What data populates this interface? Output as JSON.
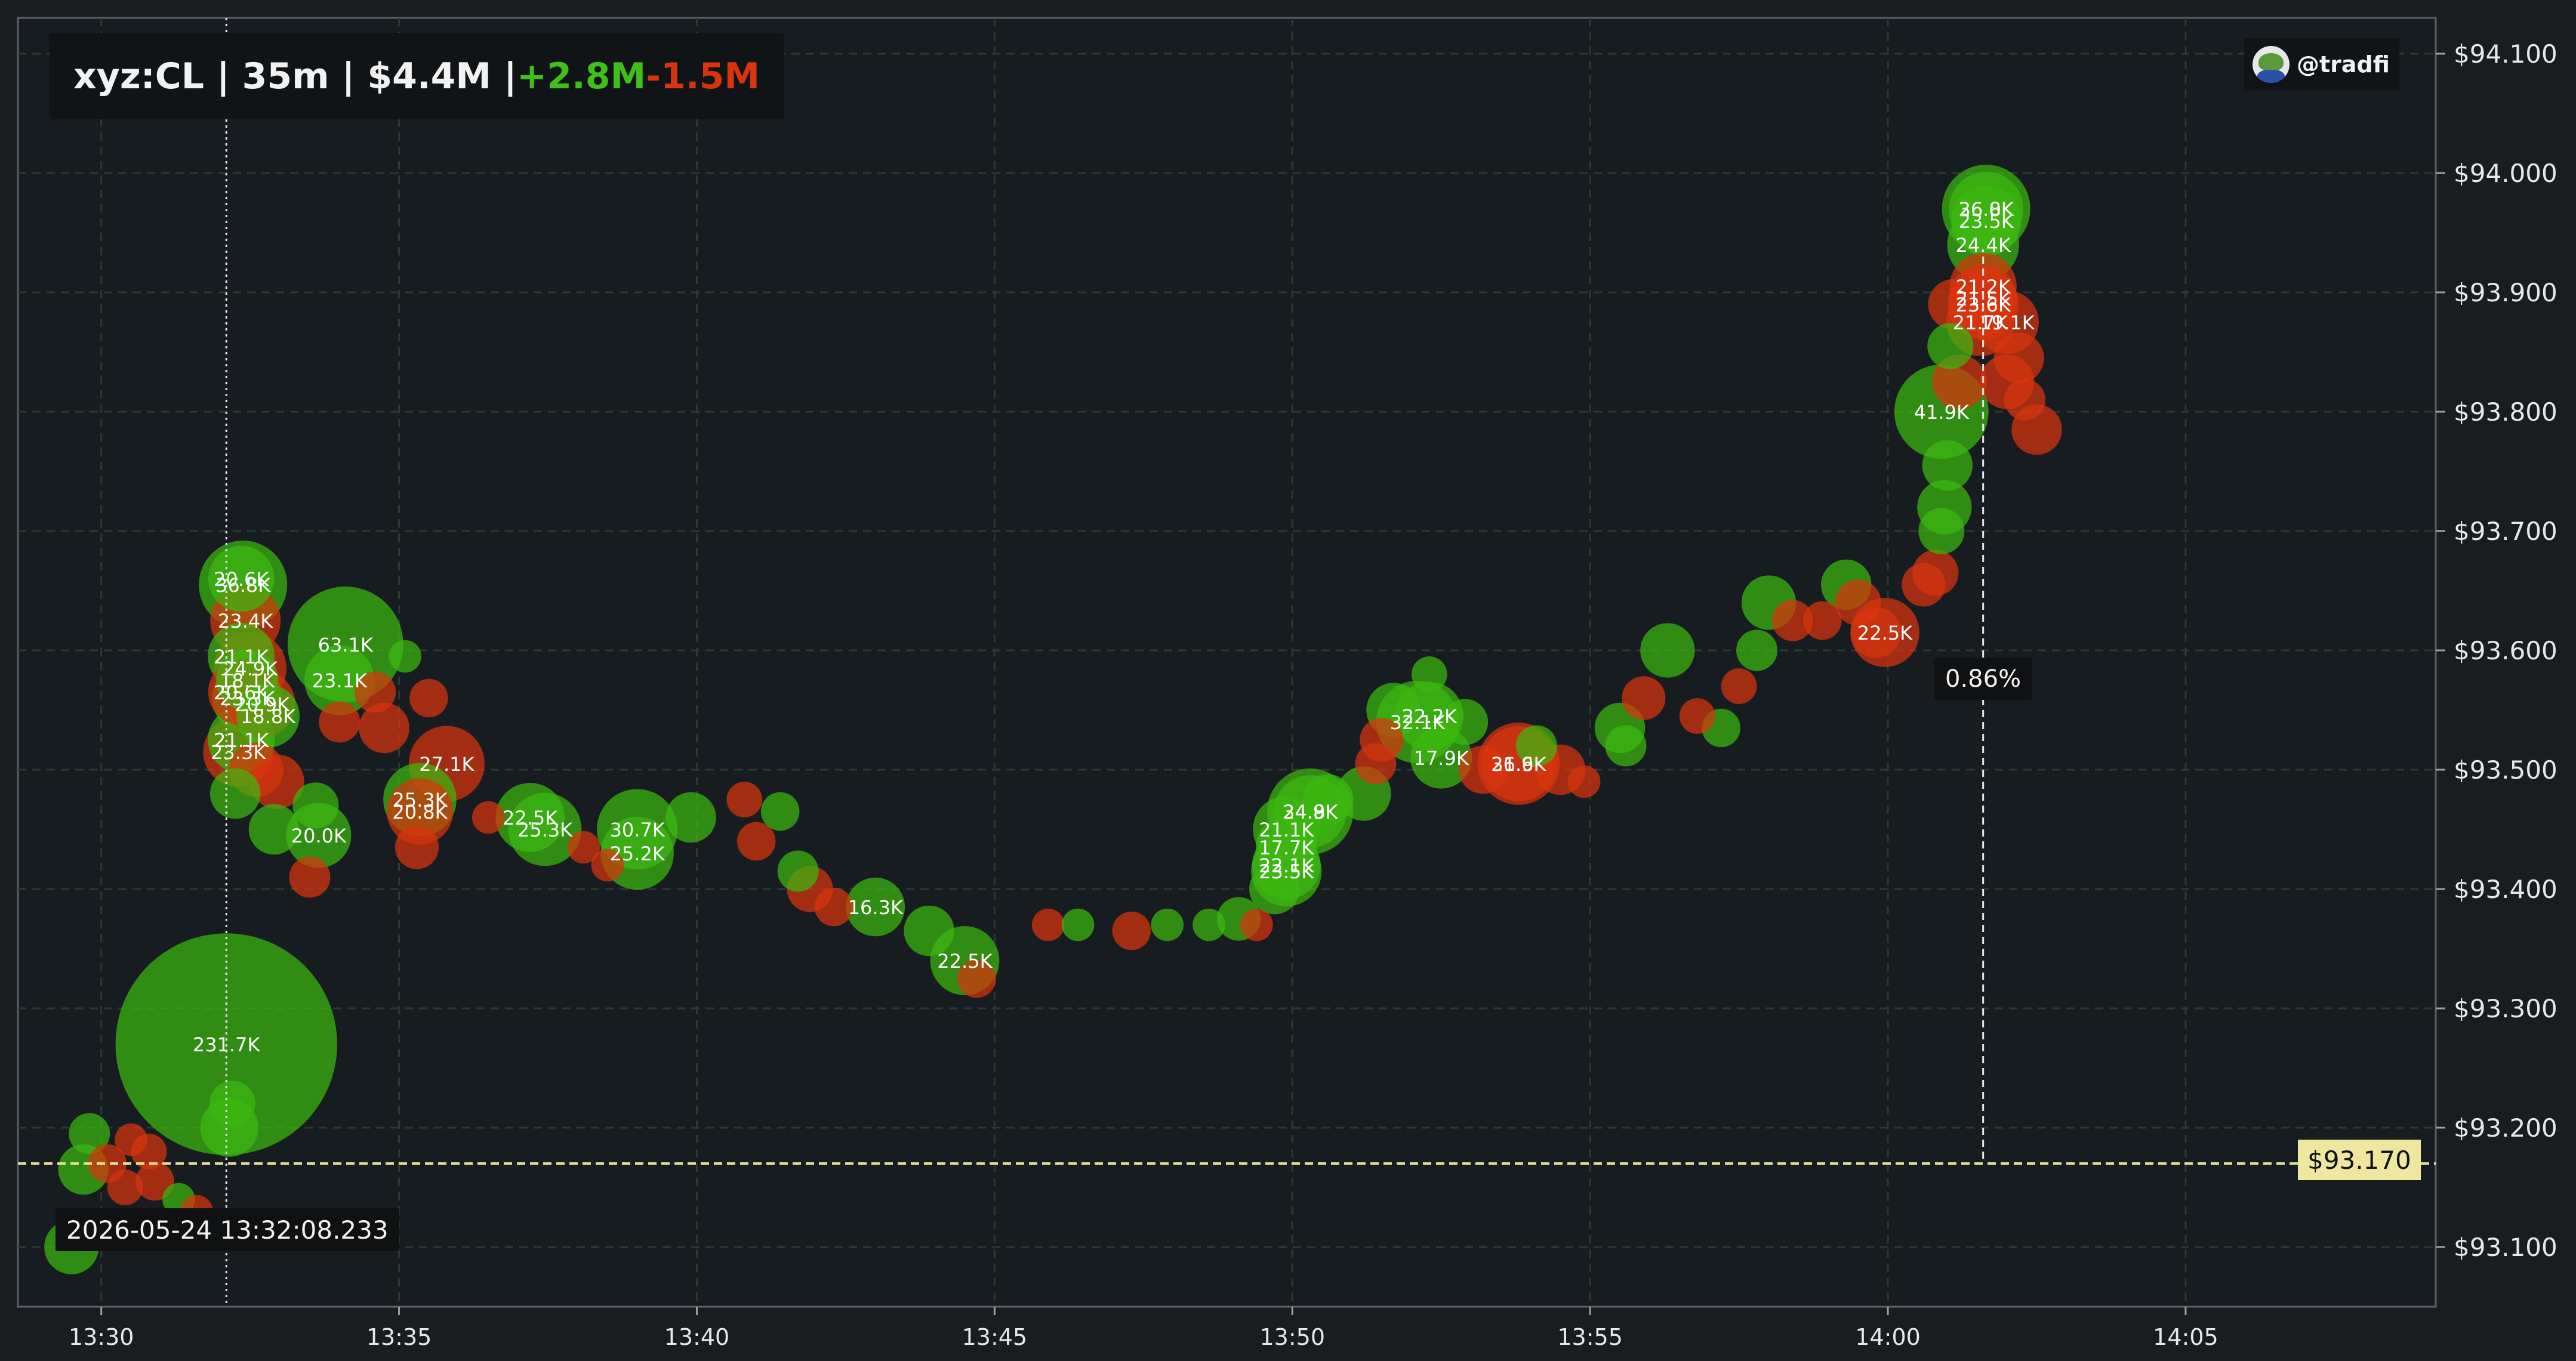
{
  "header": {
    "symbol_text": "xyz:CL | 35m | $4.4M | ",
    "buy_volume": "+2.8M",
    "sell_volume": "-1.5M"
  },
  "brand": {
    "handle": "@tradfi",
    "avatar_icon": "frog-avatar-icon"
  },
  "crosshair": {
    "time_label": "2026-05-24 13:32:08.233",
    "price_label": "$93.170",
    "price": 93.17,
    "time_min": 2.1
  },
  "measure": {
    "label": "0.86%",
    "x_min": 31.6,
    "y_top": 93.93,
    "y_bottom": 93.17
  },
  "colors": {
    "background": "#171c21",
    "buy": "#3cb80f",
    "sell": "#d8340e",
    "crosshair": "#e6df9a",
    "grid": "#2c3a33"
  },
  "chart_data": {
    "type": "scatter",
    "x_axis": {
      "unit": "minutes since 13:30",
      "range": [
        -1.4,
        39.2
      ],
      "ticks": [
        {
          "v": 0,
          "label": "13:30"
        },
        {
          "v": 5,
          "label": "13:35"
        },
        {
          "v": 10,
          "label": "13:40"
        },
        {
          "v": 15,
          "label": "13:45"
        },
        {
          "v": 20,
          "label": "13:50"
        },
        {
          "v": 25,
          "label": "13:55"
        },
        {
          "v": 30,
          "label": "14:00"
        },
        {
          "v": 35,
          "label": "14:05"
        }
      ]
    },
    "y_axis": {
      "range": [
        93.05,
        94.13
      ],
      "ticks": [
        {
          "v": 93.1,
          "label": "$93.100"
        },
        {
          "v": 93.2,
          "label": "$93.200"
        },
        {
          "v": 93.3,
          "label": "$93.300"
        },
        {
          "v": 93.4,
          "label": "$93.400"
        },
        {
          "v": 93.5,
          "label": "$93.500"
        },
        {
          "v": 93.6,
          "label": "$93.600"
        },
        {
          "v": 93.7,
          "label": "$93.700"
        },
        {
          "v": 93.8,
          "label": "$93.800"
        },
        {
          "v": 93.9,
          "label": "$93.900"
        },
        {
          "v": 94.0,
          "label": "$94.000"
        },
        {
          "v": 94.1,
          "label": "$94.100"
        }
      ]
    },
    "grid": true,
    "trades": [
      {
        "t": -0.5,
        "p": 93.1,
        "side": "buy",
        "size": 14
      },
      {
        "t": -0.3,
        "p": 93.165,
        "side": "buy",
        "size": 12
      },
      {
        "t": -0.2,
        "p": 93.195,
        "side": "buy",
        "size": 8
      },
      {
        "t": 0.1,
        "p": 93.17,
        "side": "sell",
        "size": 7
      },
      {
        "t": 0.4,
        "p": 93.15,
        "side": "sell",
        "size": 6
      },
      {
        "t": 0.5,
        "p": 93.19,
        "side": "sell",
        "size": 5
      },
      {
        "t": 0.8,
        "p": 93.18,
        "side": "sell",
        "size": 6
      },
      {
        "t": 0.9,
        "p": 93.155,
        "side": "sell",
        "size": 7
      },
      {
        "t": 1.3,
        "p": 93.14,
        "side": "buy",
        "size": 5
      },
      {
        "t": 1.6,
        "p": 93.13,
        "side": "sell",
        "size": 5
      },
      {
        "t": 2.1,
        "p": 93.27,
        "side": "buy",
        "size": 231.7,
        "label": "231.7K"
      },
      {
        "t": 2.15,
        "p": 93.2,
        "side": "buy",
        "size": 16
      },
      {
        "t": 2.2,
        "p": 93.22,
        "side": "buy",
        "size": 10
      },
      {
        "t": 2.25,
        "p": 93.48,
        "side": "buy",
        "size": 12
      },
      {
        "t": 2.35,
        "p": 93.66,
        "side": "buy",
        "size": 20.6,
        "label": "20.6K"
      },
      {
        "t": 2.38,
        "p": 93.655,
        "side": "buy",
        "size": 36.8,
        "label": "36.8K"
      },
      {
        "t": 2.42,
        "p": 93.625,
        "side": "sell",
        "size": 23.4,
        "label": "23.4K"
      },
      {
        "t": 2.35,
        "p": 93.595,
        "side": "buy",
        "size": 21.1,
        "label": "21.1K"
      },
      {
        "t": 2.5,
        "p": 93.585,
        "side": "sell",
        "size": 24.9,
        "label": "24.9K"
      },
      {
        "t": 2.45,
        "p": 93.575,
        "side": "buy",
        "size": 18.1,
        "label": "18.1K"
      },
      {
        "t": 2.35,
        "p": 93.565,
        "side": "sell",
        "size": 20.6,
        "label": "20.6K"
      },
      {
        "t": 2.45,
        "p": 93.56,
        "side": "buy",
        "size": 23.3,
        "label": "23.3K"
      },
      {
        "t": 2.7,
        "p": 93.555,
        "side": "sell",
        "size": 20.9,
        "label": "20.9K"
      },
      {
        "t": 2.8,
        "p": 93.545,
        "side": "buy",
        "size": 18.8,
        "label": "18.8K"
      },
      {
        "t": 2.35,
        "p": 93.525,
        "side": "buy",
        "size": 21.1,
        "label": "21.1K"
      },
      {
        "t": 2.3,
        "p": 93.515,
        "side": "sell",
        "size": 23.3,
        "label": "23.3K"
      },
      {
        "t": 2.6,
        "p": 93.5,
        "side": "sell",
        "size": 14
      },
      {
        "t": 2.95,
        "p": 93.49,
        "side": "sell",
        "size": 14
      },
      {
        "t": 2.9,
        "p": 93.45,
        "side": "buy",
        "size": 12
      },
      {
        "t": 3.6,
        "p": 93.47,
        "side": "buy",
        "size": 10
      },
      {
        "t": 3.65,
        "p": 93.445,
        "side": "buy",
        "size": 20.0,
        "label": "20.0K"
      },
      {
        "t": 3.5,
        "p": 93.41,
        "side": "sell",
        "size": 8
      },
      {
        "t": 4.1,
        "p": 93.605,
        "side": "buy",
        "size": 63.1,
        "label": "63.1K"
      },
      {
        "t": 4.0,
        "p": 93.575,
        "side": "buy",
        "size": 23.1,
        "label": "23.1K"
      },
      {
        "t": 4.0,
        "p": 93.54,
        "side": "sell",
        "size": 8
      },
      {
        "t": 4.6,
        "p": 93.565,
        "side": "sell",
        "size": 8
      },
      {
        "t": 4.75,
        "p": 93.535,
        "side": "sell",
        "size": 12
      },
      {
        "t": 5.1,
        "p": 93.595,
        "side": "buy",
        "size": 5
      },
      {
        "t": 5.5,
        "p": 93.56,
        "side": "sell",
        "size": 7
      },
      {
        "t": 5.8,
        "p": 93.505,
        "side": "sell",
        "size": 27.1,
        "label": "27.1K"
      },
      {
        "t": 5.35,
        "p": 93.475,
        "side": "buy",
        "size": 25.3,
        "label": "25.3K"
      },
      {
        "t": 5.35,
        "p": 93.465,
        "side": "sell",
        "size": 20.8,
        "label": "20.8K"
      },
      {
        "t": 5.3,
        "p": 93.435,
        "side": "sell",
        "size": 9
      },
      {
        "t": 6.5,
        "p": 93.46,
        "side": "sell",
        "size": 5
      },
      {
        "t": 7.2,
        "p": 93.46,
        "side": "buy",
        "size": 22.5,
        "label": "22.5K"
      },
      {
        "t": 7.45,
        "p": 93.45,
        "side": "buy",
        "size": 25.3,
        "label": "25.3K"
      },
      {
        "t": 8.1,
        "p": 93.435,
        "side": "sell",
        "size": 5
      },
      {
        "t": 8.5,
        "p": 93.42,
        "side": "sell",
        "size": 5
      },
      {
        "t": 9.0,
        "p": 93.45,
        "side": "buy",
        "size": 30.7,
        "label": "30.7K"
      },
      {
        "t": 9.0,
        "p": 93.43,
        "side": "buy",
        "size": 25.2,
        "label": "25.2K"
      },
      {
        "t": 9.9,
        "p": 93.46,
        "side": "buy",
        "size": 12
      },
      {
        "t": 10.8,
        "p": 93.475,
        "side": "sell",
        "size": 6
      },
      {
        "t": 11.0,
        "p": 93.44,
        "side": "sell",
        "size": 7
      },
      {
        "t": 11.4,
        "p": 93.465,
        "side": "buy",
        "size": 7
      },
      {
        "t": 11.7,
        "p": 93.415,
        "side": "buy",
        "size": 8
      },
      {
        "t": 11.9,
        "p": 93.4,
        "side": "sell",
        "size": 10
      },
      {
        "t": 12.3,
        "p": 93.385,
        "side": "sell",
        "size": 7
      },
      {
        "t": 13.0,
        "p": 93.385,
        "side": "buy",
        "size": 16.3,
        "label": "16.3K"
      },
      {
        "t": 13.9,
        "p": 93.365,
        "side": "buy",
        "size": 12
      },
      {
        "t": 14.5,
        "p": 93.34,
        "side": "buy",
        "size": 22.5,
        "label": "22.5K"
      },
      {
        "t": 14.7,
        "p": 93.325,
        "side": "sell",
        "size": 7
      },
      {
        "t": 15.9,
        "p": 93.37,
        "side": "sell",
        "size": 5
      },
      {
        "t": 16.4,
        "p": 93.37,
        "side": "buy",
        "size": 5
      },
      {
        "t": 17.3,
        "p": 93.365,
        "side": "sell",
        "size": 7
      },
      {
        "t": 17.9,
        "p": 93.37,
        "side": "buy",
        "size": 5
      },
      {
        "t": 18.6,
        "p": 93.37,
        "side": "buy",
        "size": 5
      },
      {
        "t": 19.1,
        "p": 93.375,
        "side": "buy",
        "size": 9
      },
      {
        "t": 19.4,
        "p": 93.37,
        "side": "sell",
        "size": 5
      },
      {
        "t": 19.7,
        "p": 93.4,
        "side": "buy",
        "size": 12
      },
      {
        "t": 19.9,
        "p": 93.415,
        "side": "buy",
        "size": 23.5,
        "label": "23.5K"
      },
      {
        "t": 19.9,
        "p": 93.42,
        "side": "buy",
        "size": 22.1,
        "label": "22.1K"
      },
      {
        "t": 19.9,
        "p": 93.435,
        "side": "buy",
        "size": 17.7,
        "label": "17.7K"
      },
      {
        "t": 19.9,
        "p": 93.45,
        "side": "buy",
        "size": 21.1,
        "label": "21.1K"
      },
      {
        "t": 20.3,
        "p": 93.465,
        "side": "buy",
        "size": 24.8,
        "label": "24.8K"
      },
      {
        "t": 20.3,
        "p": 93.465,
        "side": "buy",
        "size": 34.9,
        "label": "34.9K"
      },
      {
        "t": 20.6,
        "p": 93.475,
        "side": "buy",
        "size": 12
      },
      {
        "t": 21.2,
        "p": 93.48,
        "side": "buy",
        "size": 14
      },
      {
        "t": 21.4,
        "p": 93.505,
        "side": "sell",
        "size": 8
      },
      {
        "t": 21.5,
        "p": 93.525,
        "side": "sell",
        "size": 9
      },
      {
        "t": 21.7,
        "p": 93.55,
        "side": "buy",
        "size": 14
      },
      {
        "t": 22.1,
        "p": 93.54,
        "side": "buy",
        "size": 32.1,
        "label": "32.1K"
      },
      {
        "t": 22.3,
        "p": 93.545,
        "side": "buy",
        "size": 22.2,
        "label": "22.2K"
      },
      {
        "t": 22.3,
        "p": 93.58,
        "side": "buy",
        "size": 6
      },
      {
        "t": 22.5,
        "p": 93.51,
        "side": "buy",
        "size": 17.9,
        "label": "17.9K"
      },
      {
        "t": 22.9,
        "p": 93.54,
        "side": "buy",
        "size": 10
      },
      {
        "t": 23.2,
        "p": 93.5,
        "side": "sell",
        "size": 11
      },
      {
        "t": 23.8,
        "p": 93.505,
        "side": "sell",
        "size": 31.9,
        "label": "31.9K"
      },
      {
        "t": 23.8,
        "p": 93.505,
        "side": "sell",
        "size": 26.6,
        "label": "26.6K"
      },
      {
        "t": 24.1,
        "p": 93.52,
        "side": "buy",
        "size": 8
      },
      {
        "t": 24.5,
        "p": 93.5,
        "side": "sell",
        "size": 12
      },
      {
        "t": 24.9,
        "p": 93.49,
        "side": "sell",
        "size": 5
      },
      {
        "t": 25.5,
        "p": 93.535,
        "side": "buy",
        "size": 12
      },
      {
        "t": 25.6,
        "p": 93.52,
        "side": "buy",
        "size": 8
      },
      {
        "t": 25.9,
        "p": 93.56,
        "side": "sell",
        "size": 9
      },
      {
        "t": 26.3,
        "p": 93.6,
        "side": "buy",
        "size": 14
      },
      {
        "t": 26.8,
        "p": 93.545,
        "side": "sell",
        "size": 6
      },
      {
        "t": 27.2,
        "p": 93.535,
        "side": "buy",
        "size": 7
      },
      {
        "t": 27.5,
        "p": 93.57,
        "side": "sell",
        "size": 6
      },
      {
        "t": 27.8,
        "p": 93.6,
        "side": "buy",
        "size": 8
      },
      {
        "t": 28.0,
        "p": 93.64,
        "side": "buy",
        "size": 14
      },
      {
        "t": 28.4,
        "p": 93.625,
        "side": "sell",
        "size": 8
      },
      {
        "t": 28.9,
        "p": 93.625,
        "side": "sell",
        "size": 7
      },
      {
        "t": 29.3,
        "p": 93.655,
        "side": "buy",
        "size": 12
      },
      {
        "t": 29.5,
        "p": 93.64,
        "side": "sell",
        "size": 10
      },
      {
        "t": 29.8,
        "p": 93.615,
        "side": "sell",
        "size": 12
      },
      {
        "t": 29.95,
        "p": 93.615,
        "side": "sell",
        "size": 22.5,
        "label": "22.5K"
      },
      {
        "t": 30.6,
        "p": 93.655,
        "side": "sell",
        "size": 9
      },
      {
        "t": 30.8,
        "p": 93.665,
        "side": "sell",
        "size": 10
      },
      {
        "t": 30.9,
        "p": 93.7,
        "side": "buy",
        "size": 10
      },
      {
        "t": 30.95,
        "p": 93.72,
        "side": "buy",
        "size": 14
      },
      {
        "t": 31.0,
        "p": 93.755,
        "side": "buy",
        "size": 12
      },
      {
        "t": 30.9,
        "p": 93.8,
        "side": "buy",
        "size": 41.9,
        "label": "41.9K"
      },
      {
        "t": 31.05,
        "p": 93.855,
        "side": "buy",
        "size": 10
      },
      {
        "t": 31.2,
        "p": 93.825,
        "side": "sell",
        "size": 14
      },
      {
        "t": 31.1,
        "p": 93.89,
        "side": "sell",
        "size": 12
      },
      {
        "t": 31.55,
        "p": 93.875,
        "side": "sell",
        "size": 21.7,
        "label": "21.7K"
      },
      {
        "t": 31.6,
        "p": 93.89,
        "side": "sell",
        "size": 23.6,
        "label": "23.6K"
      },
      {
        "t": 31.6,
        "p": 93.895,
        "side": "sell",
        "size": 21.5,
        "label": "21.5K"
      },
      {
        "t": 31.6,
        "p": 93.905,
        "side": "sell",
        "size": 21.2,
        "label": "21.2K"
      },
      {
        "t": 31.6,
        "p": 93.94,
        "side": "buy",
        "size": 24.4,
        "label": "24.4K"
      },
      {
        "t": 31.65,
        "p": 93.96,
        "side": "buy",
        "size": 23.5,
        "label": "23.5K"
      },
      {
        "t": 31.65,
        "p": 93.97,
        "side": "buy",
        "size": 26.0,
        "label": "26.0K"
      },
      {
        "t": 31.65,
        "p": 93.97,
        "side": "buy",
        "size": 36.8,
        "label": "36.8K"
      },
      {
        "t": 32.0,
        "p": 93.875,
        "side": "sell",
        "size": 19.1,
        "label": "19.1K"
      },
      {
        "t": 32.0,
        "p": 93.825,
        "side": "sell",
        "size": 14
      },
      {
        "t": 32.2,
        "p": 93.845,
        "side": "sell",
        "size": 12
      },
      {
        "t": 32.3,
        "p": 93.81,
        "side": "sell",
        "size": 8
      },
      {
        "t": 32.5,
        "p": 93.785,
        "side": "sell",
        "size": 12
      }
    ]
  }
}
